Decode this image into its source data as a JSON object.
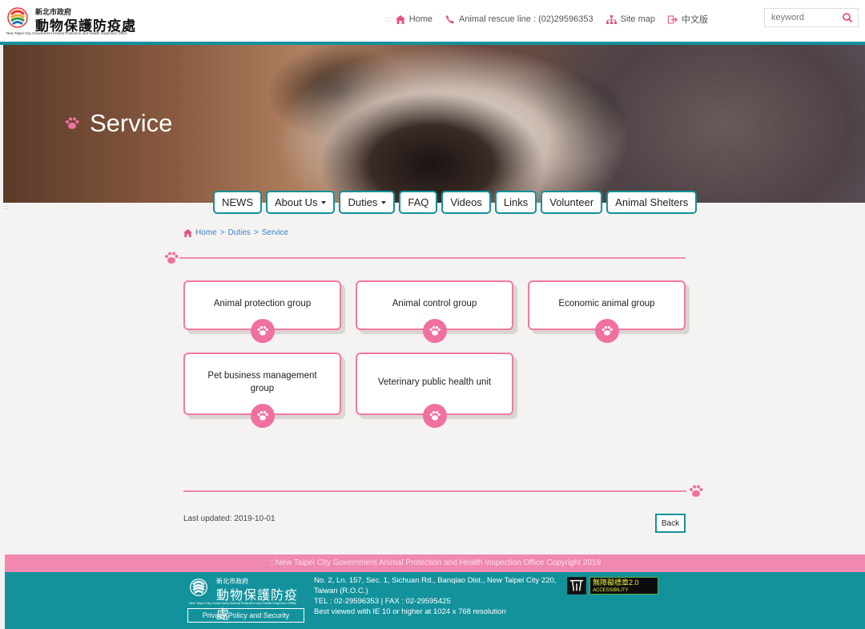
{
  "header": {
    "logo_small": "新北市政府",
    "logo_big": "動物保護防疫處",
    "logo_en": "New Taipei City Government Animal Protection and Health Inspection Office",
    "acc_key": ":::",
    "links": {
      "home": "Home",
      "rescue": "Animal rescue line : (02)29596353",
      "sitemap": "Site map",
      "lang": "中文版"
    },
    "search_placeholder": "keyword"
  },
  "banner": {
    "title": "Service"
  },
  "nav": {
    "items": [
      "NEWS",
      "About Us",
      "Duties",
      "FAQ",
      "Videos",
      "Links",
      "Volunteer",
      "Animal Shelters"
    ]
  },
  "side_key": ":::",
  "breadcrumb": {
    "home": "Home",
    "sep1": ">",
    "duties": "Duties",
    "sep2": ">",
    "current": "Service"
  },
  "cards": [
    "Animal protection group",
    "Animal control group",
    "Economic animal group",
    "Pet business management group",
    "Veterinary public health unit"
  ],
  "last_updated": "Last updated: 2019-10-01",
  "back_label": "Back",
  "footer": {
    "copyright": ":::New Taipei City Government Animal Protection and Health Inspection Office Copyright 2019",
    "logo_small": "新北市政府",
    "logo_big": "動物保護防疫處",
    "logo_en": "New Taipei City Government Animal Protection and Health Inspection Office",
    "privacy": "Privacy Policy and Security",
    "address1": "No. 2, Ln. 157, Sec. 1, Sichuan Rd., Banqiao Dist., New Taipei City 220,",
    "address2": "Taiwan (R.O.C.)",
    "tel": "TEL : 02-29596353 | FAX : 02-29595425",
    "best_view": "Best viewed with IE 10 or higher at 1024 x 768 resolution",
    "acc_badge": "無障礙標章2.0",
    "acc_badge_sub": "ACCESSIBILITY"
  },
  "colors": {
    "teal": "#13929c",
    "pink": "#f070a0",
    "link": "#3a7fd0"
  }
}
